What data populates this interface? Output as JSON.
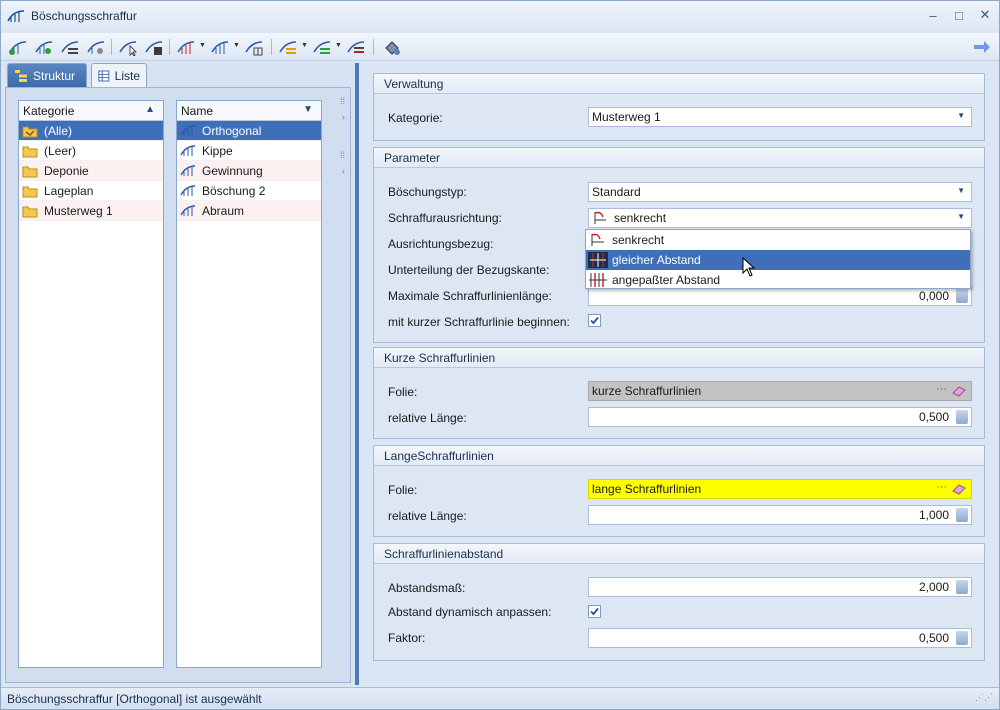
{
  "window": {
    "title": "Böschungsschraffur"
  },
  "window_controls": {
    "minimize": "–",
    "maximize": "□",
    "close": "✕"
  },
  "toolbar": {
    "icons": [
      "new-hatch-icon",
      "new-hatch-alt-icon",
      "hatch-list-icon",
      "hatch-copy-icon",
      "hatch-select-icon",
      "hatch-edit-icon",
      "hatch-dropdown-icon",
      "hatch-dropdown-2-icon",
      "hatch-grid-icon",
      "hatch-props-icon",
      "hatch-props-2-icon",
      "hatch-settings-icon",
      "paint-icon",
      "arrow-right-icon"
    ]
  },
  "left_panel": {
    "tabs": [
      {
        "label": "Struktur",
        "icon": "tree-icon",
        "active": true
      },
      {
        "label": "Liste",
        "icon": "list-icon",
        "active": false
      }
    ],
    "category_list": {
      "header": "Kategorie",
      "sort_indicator": "▲",
      "items": [
        {
          "label": "(Alle)",
          "selected": true,
          "icon": "hand-folder-icon"
        },
        {
          "label": "(Leer)",
          "selected": false,
          "icon": "folder-icon"
        },
        {
          "label": "Deponie",
          "selected": false,
          "icon": "folder-icon"
        },
        {
          "label": "Lageplan",
          "selected": false,
          "icon": "folder-icon"
        },
        {
          "label": "Musterweg 1",
          "selected": false,
          "icon": "folder-icon"
        }
      ]
    },
    "name_list": {
      "header": "Name",
      "sort_indicator": "▼",
      "items": [
        {
          "label": "Orthogonal",
          "selected": true
        },
        {
          "label": "Kippe",
          "selected": false
        },
        {
          "label": "Gewinnung",
          "selected": false
        },
        {
          "label": "Böschung 2",
          "selected": false
        },
        {
          "label": "Abraum",
          "selected": false
        }
      ]
    }
  },
  "groups": {
    "verwaltung": {
      "title": "Verwaltung",
      "kategorie_label": "Kategorie:",
      "kategorie_value": "Musterweg 1"
    },
    "parameter": {
      "title": "Parameter",
      "boeschungstyp_label": "Böschungstyp:",
      "boeschungstyp_value": "Standard",
      "ausrichtung_label": "Schraffurausrichtung:",
      "ausrichtung_value": "senkrecht",
      "bezug_label": "Ausrichtungsbezug:",
      "unterteilung_label": "Unterteilung der Bezugskante:",
      "maxlaenge_label": "Maximale Schraffurlinienlänge:",
      "maxlaenge_value": "0,000",
      "kurz_label": "mit kurzer Schraffurlinie beginnen:",
      "kurz_checked": true
    },
    "kurze": {
      "title": "Kurze Schraffurlinien",
      "folie_label": "Folie:",
      "folie_value": "kurze Schraffurlinien",
      "folie_color": "#c3c3c3",
      "laenge_label": "relative Länge:",
      "laenge_value": "0,500"
    },
    "lange": {
      "title": "LangeSchraffurlinien",
      "folie_label": "Folie:",
      "folie_value": "lange Schraffurlinien",
      "folie_color": "#ffff00",
      "laenge_label": "relative Länge:",
      "laenge_value": "1,000"
    },
    "abstand": {
      "title": "Schraffurlinienabstand",
      "mass_label": "Abstandsmaß:",
      "mass_value": "2,000",
      "dyn_label": "Abstand dynamisch anpassen:",
      "dyn_checked": true,
      "faktor_label": "Faktor:",
      "faktor_value": "0,500"
    }
  },
  "dropdown": {
    "items": [
      {
        "label": "senkrecht",
        "selected": false,
        "icon": "perpendicular-hatch-icon"
      },
      {
        "label": "gleicher Abstand",
        "selected": true,
        "icon": "equal-spacing-hatch-icon"
      },
      {
        "label": "angepaßter Abstand",
        "selected": false,
        "icon": "adapted-spacing-hatch-icon"
      }
    ]
  },
  "ellipsis": "···",
  "status": {
    "text": "Böschungsschraffur [Orthogonal] ist ausgewählt"
  },
  "colors": {
    "selection": "#3e6fb8",
    "accent": "#4d7ab8"
  }
}
